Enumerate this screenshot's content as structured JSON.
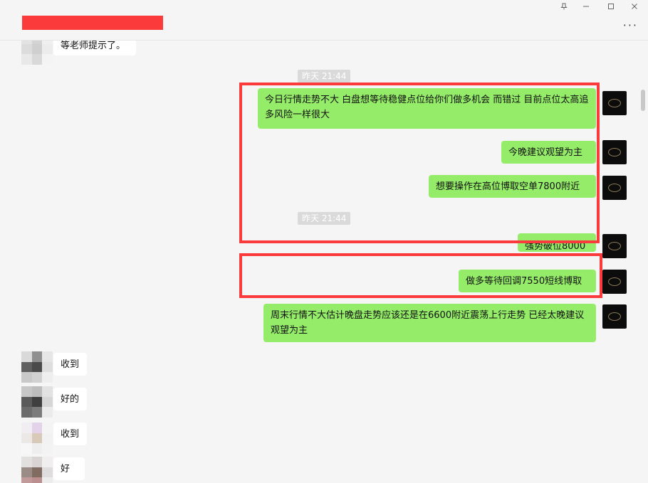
{
  "window": {
    "pin_icon": "pin-icon",
    "minimize_icon": "minimize-icon",
    "maximize_icon": "maximize-icon",
    "close_icon": "close-icon",
    "more_icon": "more-icon"
  },
  "colors": {
    "my_bubble": "#95ec69",
    "other_bubble": "#ffffff",
    "highlight_box": "#fb3b3b",
    "background": "#f5f5f5"
  },
  "messages": {
    "top_partial": "等老师提示了。",
    "time1": "昨天 21:44",
    "m1": "今日行情走势不大  白盘想等待稳健点位给你们做多机会 而错过  目前点位太高追多风险一样很大",
    "m2": "今晚建议观望为主",
    "m3": "想要操作在高位博取空单7800附近",
    "time2": "昨天 21:44",
    "m4": "强势破位8000",
    "m5": "做多等待回调7550短线博取",
    "m6": "周末行情不大估计晚盘走势应该还是在6600附近震荡上行走势  已经太晚建议观望为主",
    "r1": "收到",
    "r2": "好的",
    "r3": "收到",
    "r4": "好"
  }
}
